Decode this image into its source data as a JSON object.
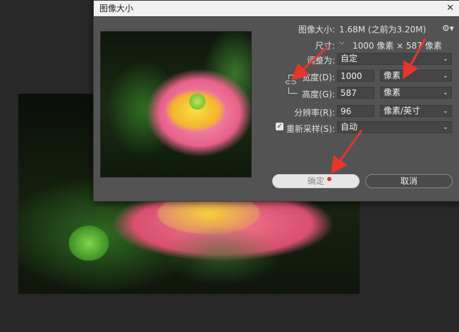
{
  "dialog": {
    "title": "图像大小",
    "close": "✕",
    "image_size_label": "图像大小:",
    "image_size_value": "1.68M (之前为3.20M)",
    "dimensions_label": "尺寸:",
    "dimensions_value": "1000 像素  ×  587 像素",
    "fit_label": "调整为:",
    "fit_value": "自定",
    "width_label": "宽度(D):",
    "width_value": "1000",
    "width_unit": "像素",
    "height_label": "高度(G):",
    "height_value": "587",
    "height_unit": "像素",
    "resolution_label": "分辨率(R):",
    "resolution_value": "96",
    "resolution_unit": "像素/英寸",
    "resample_label": "重新采样(S):",
    "resample_value": "自动",
    "resample_checked": true,
    "ok_label": "确定",
    "cancel_label": "取消"
  },
  "icons": {
    "close": "close-icon",
    "gear": "gear-icon",
    "link": "chain-link-icon",
    "chevron": "chevron-down-icon"
  },
  "colors": {
    "dialog_bg": "#535353",
    "annotation_arrow": "#e8352b"
  }
}
